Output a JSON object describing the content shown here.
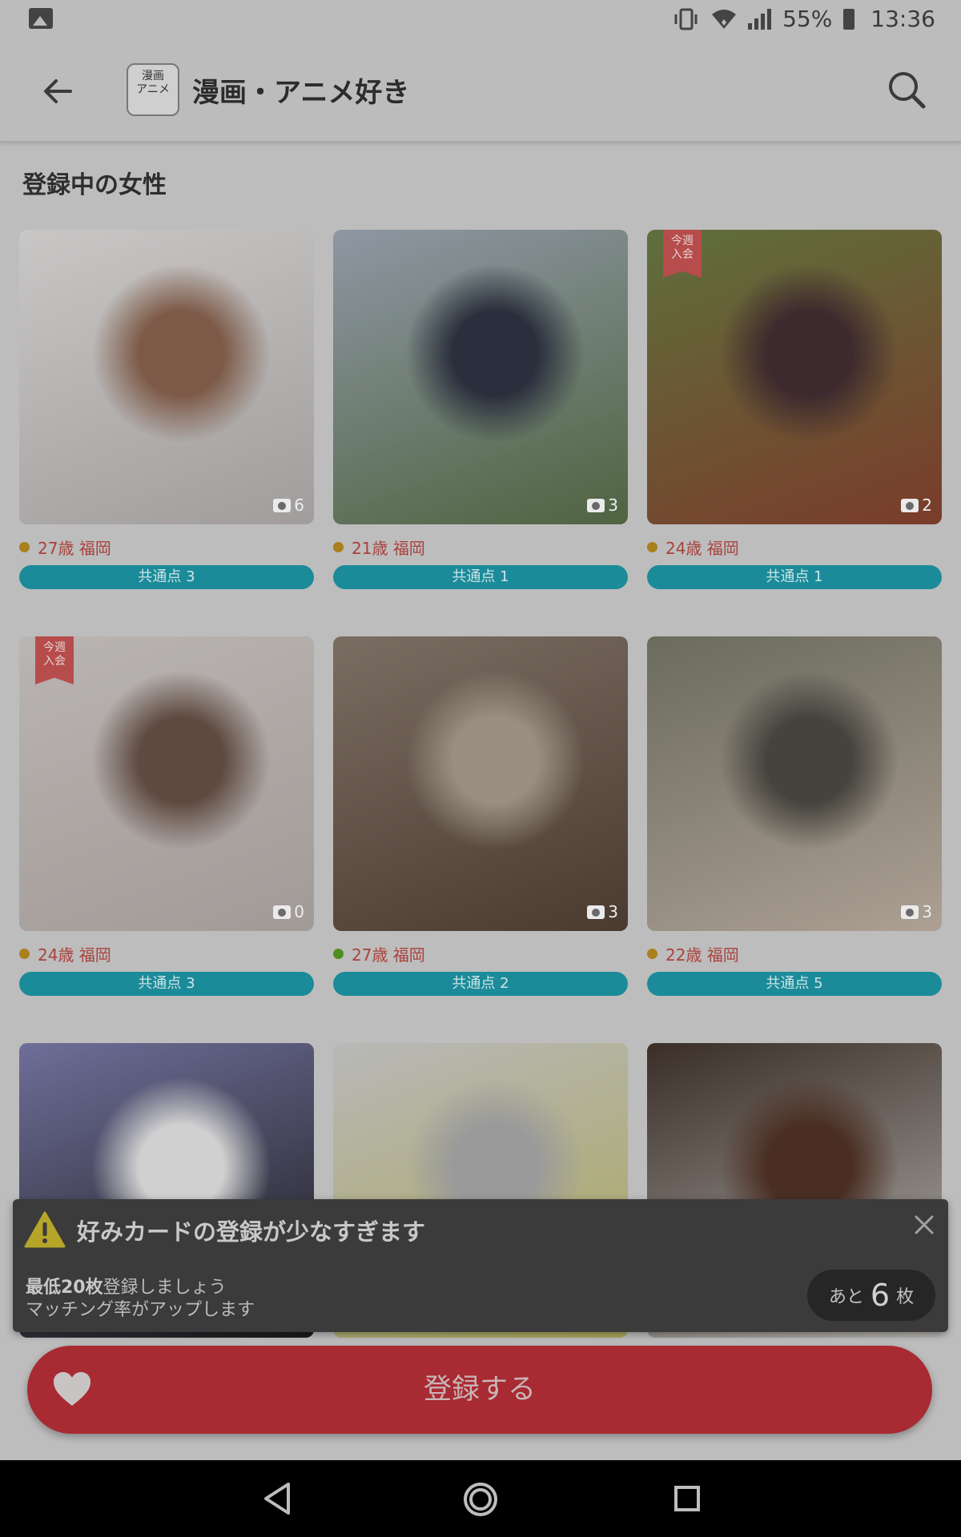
{
  "status_bar": {
    "battery": "55%",
    "time": "13:36"
  },
  "header": {
    "title": "漫画・アニメ好き",
    "community_icon_text": [
      "漫画",
      "アニメ"
    ]
  },
  "section": {
    "title": "登録中の女性"
  },
  "cards": [
    {
      "age_location": "27歳 福岡",
      "common": "共通点 3",
      "photo_count": "6",
      "new_badge": "",
      "status": "yellow",
      "colors": [
        "#c9c7c6",
        "#a09d9c",
        "#7d5a48"
      ]
    },
    {
      "age_location": "21歳 福岡",
      "common": "共通点 1",
      "photo_count": "3",
      "new_badge": "",
      "status": "yellow",
      "colors": [
        "#8e97a4",
        "#4f6440",
        "#2a2f3d"
      ]
    },
    {
      "age_location": "24歳 福岡",
      "common": "共通点 1",
      "photo_count": "2",
      "new_badge": "今週\n入会",
      "status": "yellow",
      "colors": [
        "#5e6f3c",
        "#7a3c2a",
        "#3d2a2e"
      ]
    },
    {
      "age_location": "24歳 福岡",
      "common": "共通点 3",
      "photo_count": "0",
      "new_badge": "今週\n入会",
      "status": "yellow",
      "colors": [
        "#b9b5b2",
        "#a29a97",
        "#5e4a40"
      ]
    },
    {
      "age_location": "27歳 福岡",
      "common": "共通点 2",
      "photo_count": "3",
      "new_badge": "",
      "status": "green",
      "colors": [
        "#7a6d62",
        "#4a3a30",
        "#9a8f82"
      ]
    },
    {
      "age_location": "22歳 福岡",
      "common": "共通点 5",
      "photo_count": "3",
      "new_badge": "",
      "status": "yellow",
      "colors": [
        "#6a6b5e",
        "#ad9f94",
        "#45433d"
      ]
    },
    {
      "age_location": "",
      "common": "",
      "photo_count": "",
      "new_badge": "",
      "status": "",
      "colors": [
        "#6e6e99",
        "#1a1a1a",
        "#d0d0d0"
      ]
    },
    {
      "age_location": "",
      "common": "",
      "photo_count": "",
      "new_badge": "",
      "status": "",
      "colors": [
        "#b8b8b8",
        "#a9a659",
        "#9a9a9a"
      ]
    },
    {
      "age_location": "",
      "common": "",
      "photo_count": "",
      "new_badge": "",
      "status": "",
      "colors": [
        "#3a2e27",
        "#b7b4b0",
        "#4a2e22"
      ]
    }
  ],
  "toast": {
    "title": "好みカードの登録が少なすぎます",
    "line1_bold": "最低20枚",
    "line1_rest": "登録しましょう",
    "line2": "マッチング率がアップします",
    "remaining_prefix": "あと",
    "remaining_count": "6",
    "remaining_suffix": "枚"
  },
  "register_button": {
    "label": "登録する"
  }
}
